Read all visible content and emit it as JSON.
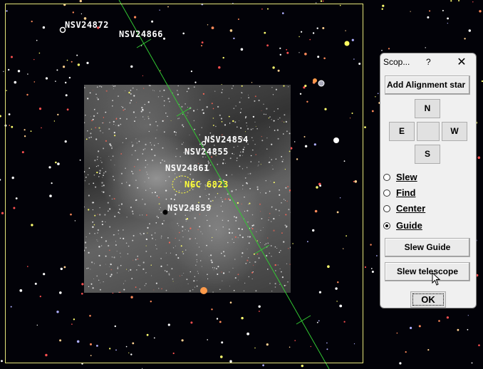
{
  "sky": {
    "labels": {
      "nsv24872": "NSV24872",
      "nsv24866": "NSV24866",
      "nsv24854": "NSV24854",
      "nsv24855": "NSV24855",
      "nsv24861": "NSV24861",
      "ngc6823": "NGC 6823",
      "nsv24859": "NSV24859"
    },
    "colors": {
      "background": "#020208",
      "fov_border": "#e6e67a",
      "meridian_line": "#32c832",
      "star_label": "#ffffff",
      "dso_label": "#ffff3a"
    }
  },
  "dialog": {
    "title": "Scop...",
    "help": "?",
    "close": "✕",
    "add_alignment_star": "Add Alignment star",
    "dir_n": "N",
    "dir_e": "E",
    "dir_w": "W",
    "dir_s": "S",
    "modes": [
      {
        "label": "Slew",
        "selected": false
      },
      {
        "label": "Find",
        "selected": false
      },
      {
        "label": "Center",
        "selected": false
      },
      {
        "label": "Guide",
        "selected": true
      }
    ],
    "slew_guide": "Slew Guide",
    "slew_telescope": "Slew telescope",
    "ok": "OK"
  }
}
